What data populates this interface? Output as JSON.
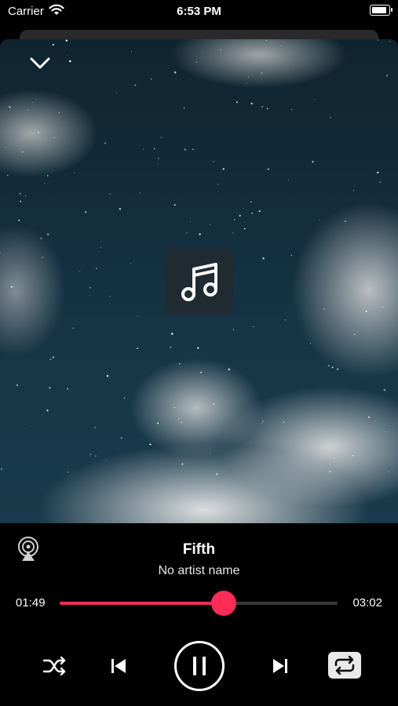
{
  "status": {
    "carrier": "Carrier",
    "time": "6:53 PM"
  },
  "track": {
    "title": "Fifth",
    "artist": "No artist name"
  },
  "playback": {
    "elapsed": "01:49",
    "total": "03:02",
    "progress": 0.59,
    "is_playing": true,
    "repeat_on": true
  },
  "colors": {
    "accent": "#ff2d55",
    "background": "#000000",
    "track_bg": "#3a3a3c"
  },
  "icons": {
    "dismiss": "chevron-down-icon",
    "artwork": "music-note-icon",
    "airplay": "airplay-icon",
    "shuffle": "shuffle-icon",
    "previous": "skip-back-icon",
    "pause": "pause-icon",
    "next": "skip-forward-icon",
    "repeat": "repeat-icon"
  }
}
